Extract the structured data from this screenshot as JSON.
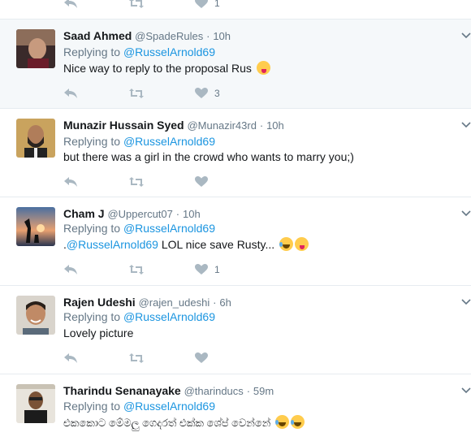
{
  "top_partial": {
    "like_count": "1"
  },
  "tweets": [
    {
      "name": "Saad Ahmed",
      "handle": "@SpadeRules",
      "time": "10h",
      "replying_prefix": "Replying to",
      "replying_to": "@RusselArnold69",
      "text": "Nice way to reply to the proposal Rus",
      "like_count": "3"
    },
    {
      "name": "Munazir Hussain Syed",
      "handle": "@Munazir43rd",
      "time": "10h",
      "replying_prefix": "Replying to",
      "replying_to": "@RusselArnold69",
      "text": "but there was a girl in the crowd who wants to marry you;)",
      "like_count": ""
    },
    {
      "name": "Cham J",
      "handle": "@Uppercut07",
      "time": "10h",
      "replying_prefix": "Replying to",
      "replying_to": "@RusselArnold69",
      "text_prefix": ".",
      "text_mention": "@RusselArnold69",
      "text": " LOL nice save Rusty...",
      "like_count": "1"
    },
    {
      "name": "Rajen Udeshi",
      "handle": "@rajen_udeshi",
      "time": "6h",
      "replying_prefix": "Replying to",
      "replying_to": "@RusselArnold69",
      "text": "Lovely picture",
      "like_count": ""
    },
    {
      "name": "Tharindu Senanayake",
      "handle": "@tharinducs",
      "time": "59m",
      "replying_prefix": "Replying to",
      "replying_to": "@RusselArnold69",
      "text": "එකකොට මේමලු ගෙදරත් එක්ක ශේප් වෙන්නේ"
    }
  ],
  "separator": "·",
  "icons": [
    "reply-icon",
    "retweet-icon",
    "like-icon",
    "chevron-down-icon"
  ],
  "colors": {
    "link": "#1b95e0",
    "muted": "#657786",
    "highlight": "#f5f8fa"
  }
}
